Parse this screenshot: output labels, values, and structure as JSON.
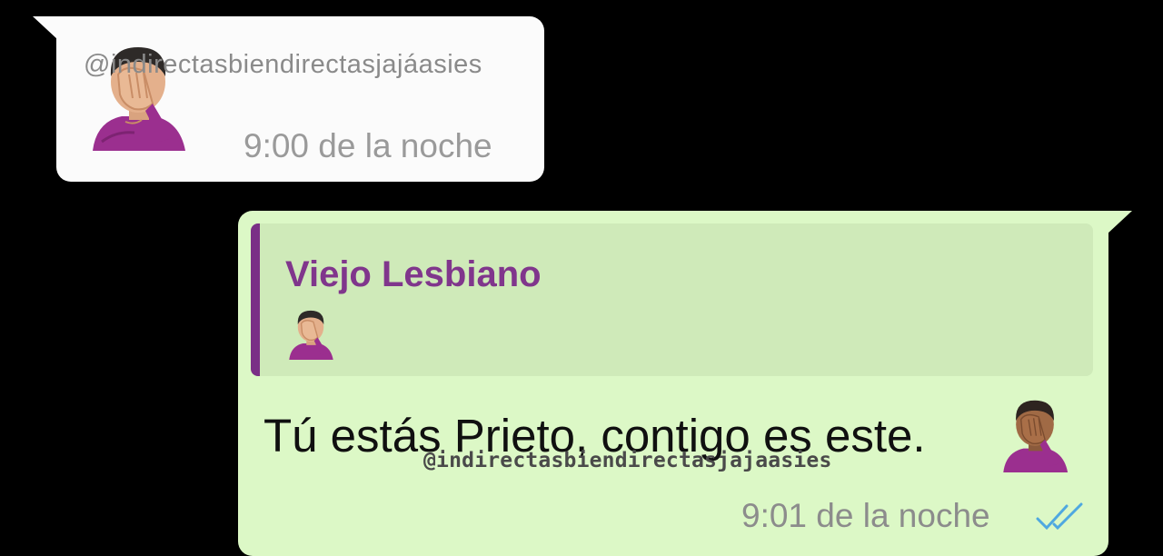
{
  "incoming_message": {
    "watermark": "@indirectasbiendirectasjajáasies",
    "emoji": "man-facepalming-emoji",
    "time": "9:00 de la noche"
  },
  "outgoing_message": {
    "quoted": {
      "author": "Viejo Lesbiano",
      "emoji": "man-facepalming-emoji"
    },
    "text": "Tú estás Prieto, contigo es este.",
    "emoji": "man-facepalming-emoji-dark-skin",
    "watermark": "@indirectasbiendirectasjajaasies",
    "time": "9:01 de la noche",
    "status_icon": "double-check-read-icon"
  },
  "colors": {
    "background": "#000000",
    "incoming_bubble": "#fbfbfb",
    "outgoing_bubble": "#dcf8c6",
    "quote_accent": "#7a2f86",
    "read_ticks": "#4fa8e0"
  }
}
